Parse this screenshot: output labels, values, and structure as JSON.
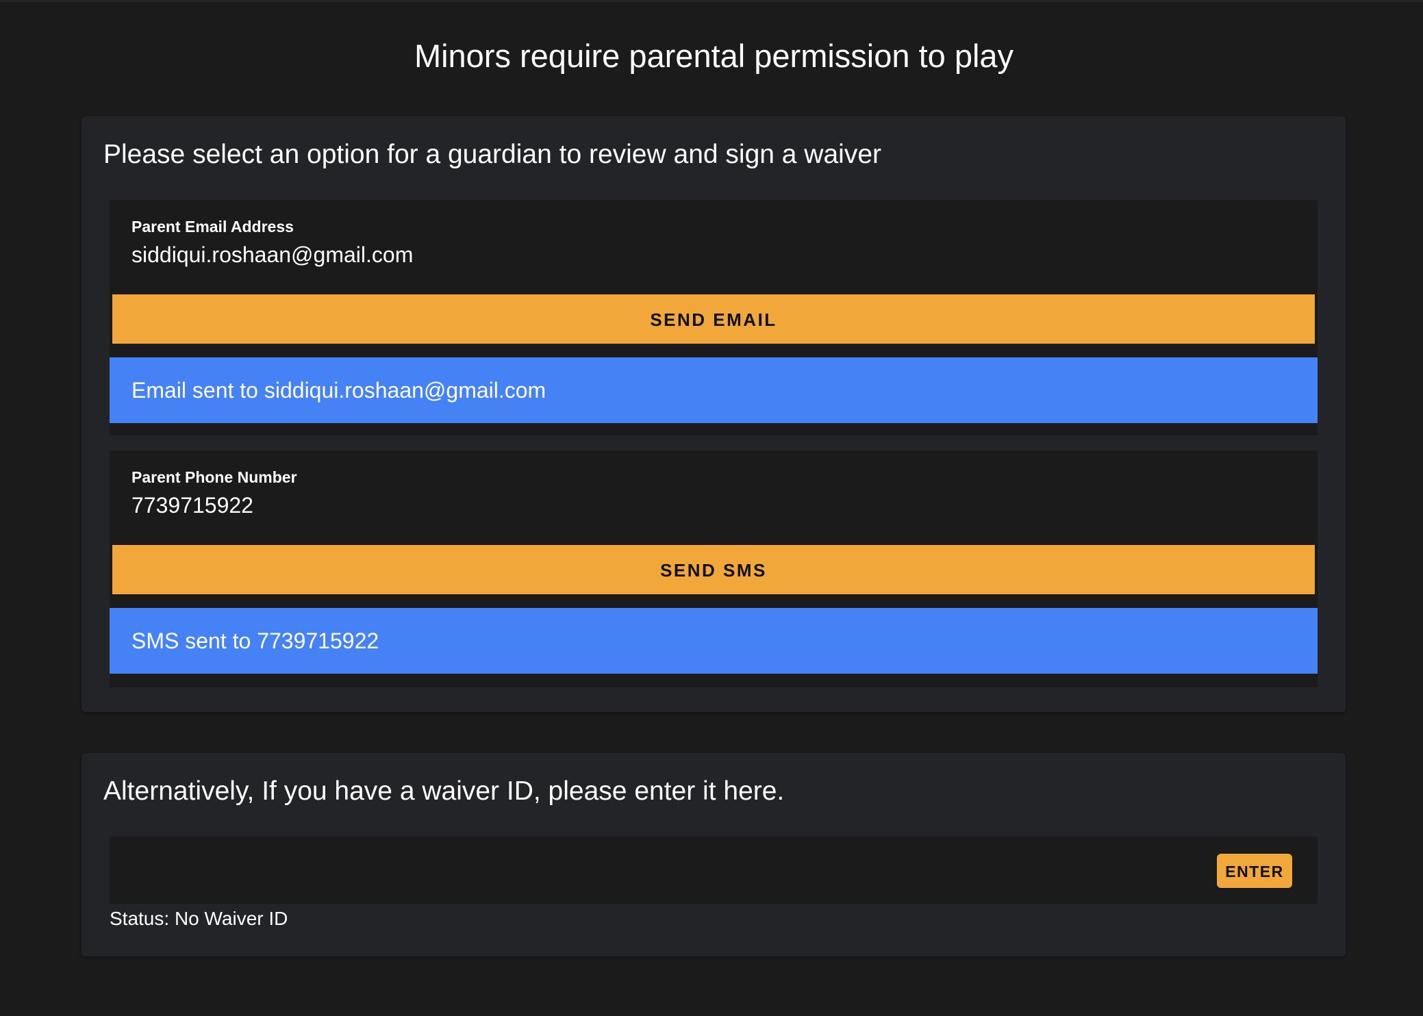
{
  "page": {
    "title": "Minors require parental permission to play"
  },
  "guardian_card": {
    "heading": "Please select an option for a guardian to review and sign a waiver",
    "email": {
      "label": "Parent Email Address",
      "value": "siddiqui.roshaan@gmail.com",
      "button_label": "SEND EMAIL",
      "alert": "Email sent to siddiqui.roshaan@gmail.com"
    },
    "phone": {
      "label": "Parent Phone Number",
      "value": "7739715922",
      "button_label": "SEND SMS",
      "alert": "SMS sent to 7739715922"
    }
  },
  "waiver_card": {
    "heading": "Alternatively, If you have a waiver ID, please enter it here.",
    "input_value": "",
    "enter_label": "ENTER",
    "status": "Status: No Waiver ID"
  },
  "colors": {
    "background": "#1b1b1c",
    "card": "#232428",
    "button": "#f2a73b",
    "info_alert": "#4582f5",
    "text": "#ffffff"
  }
}
